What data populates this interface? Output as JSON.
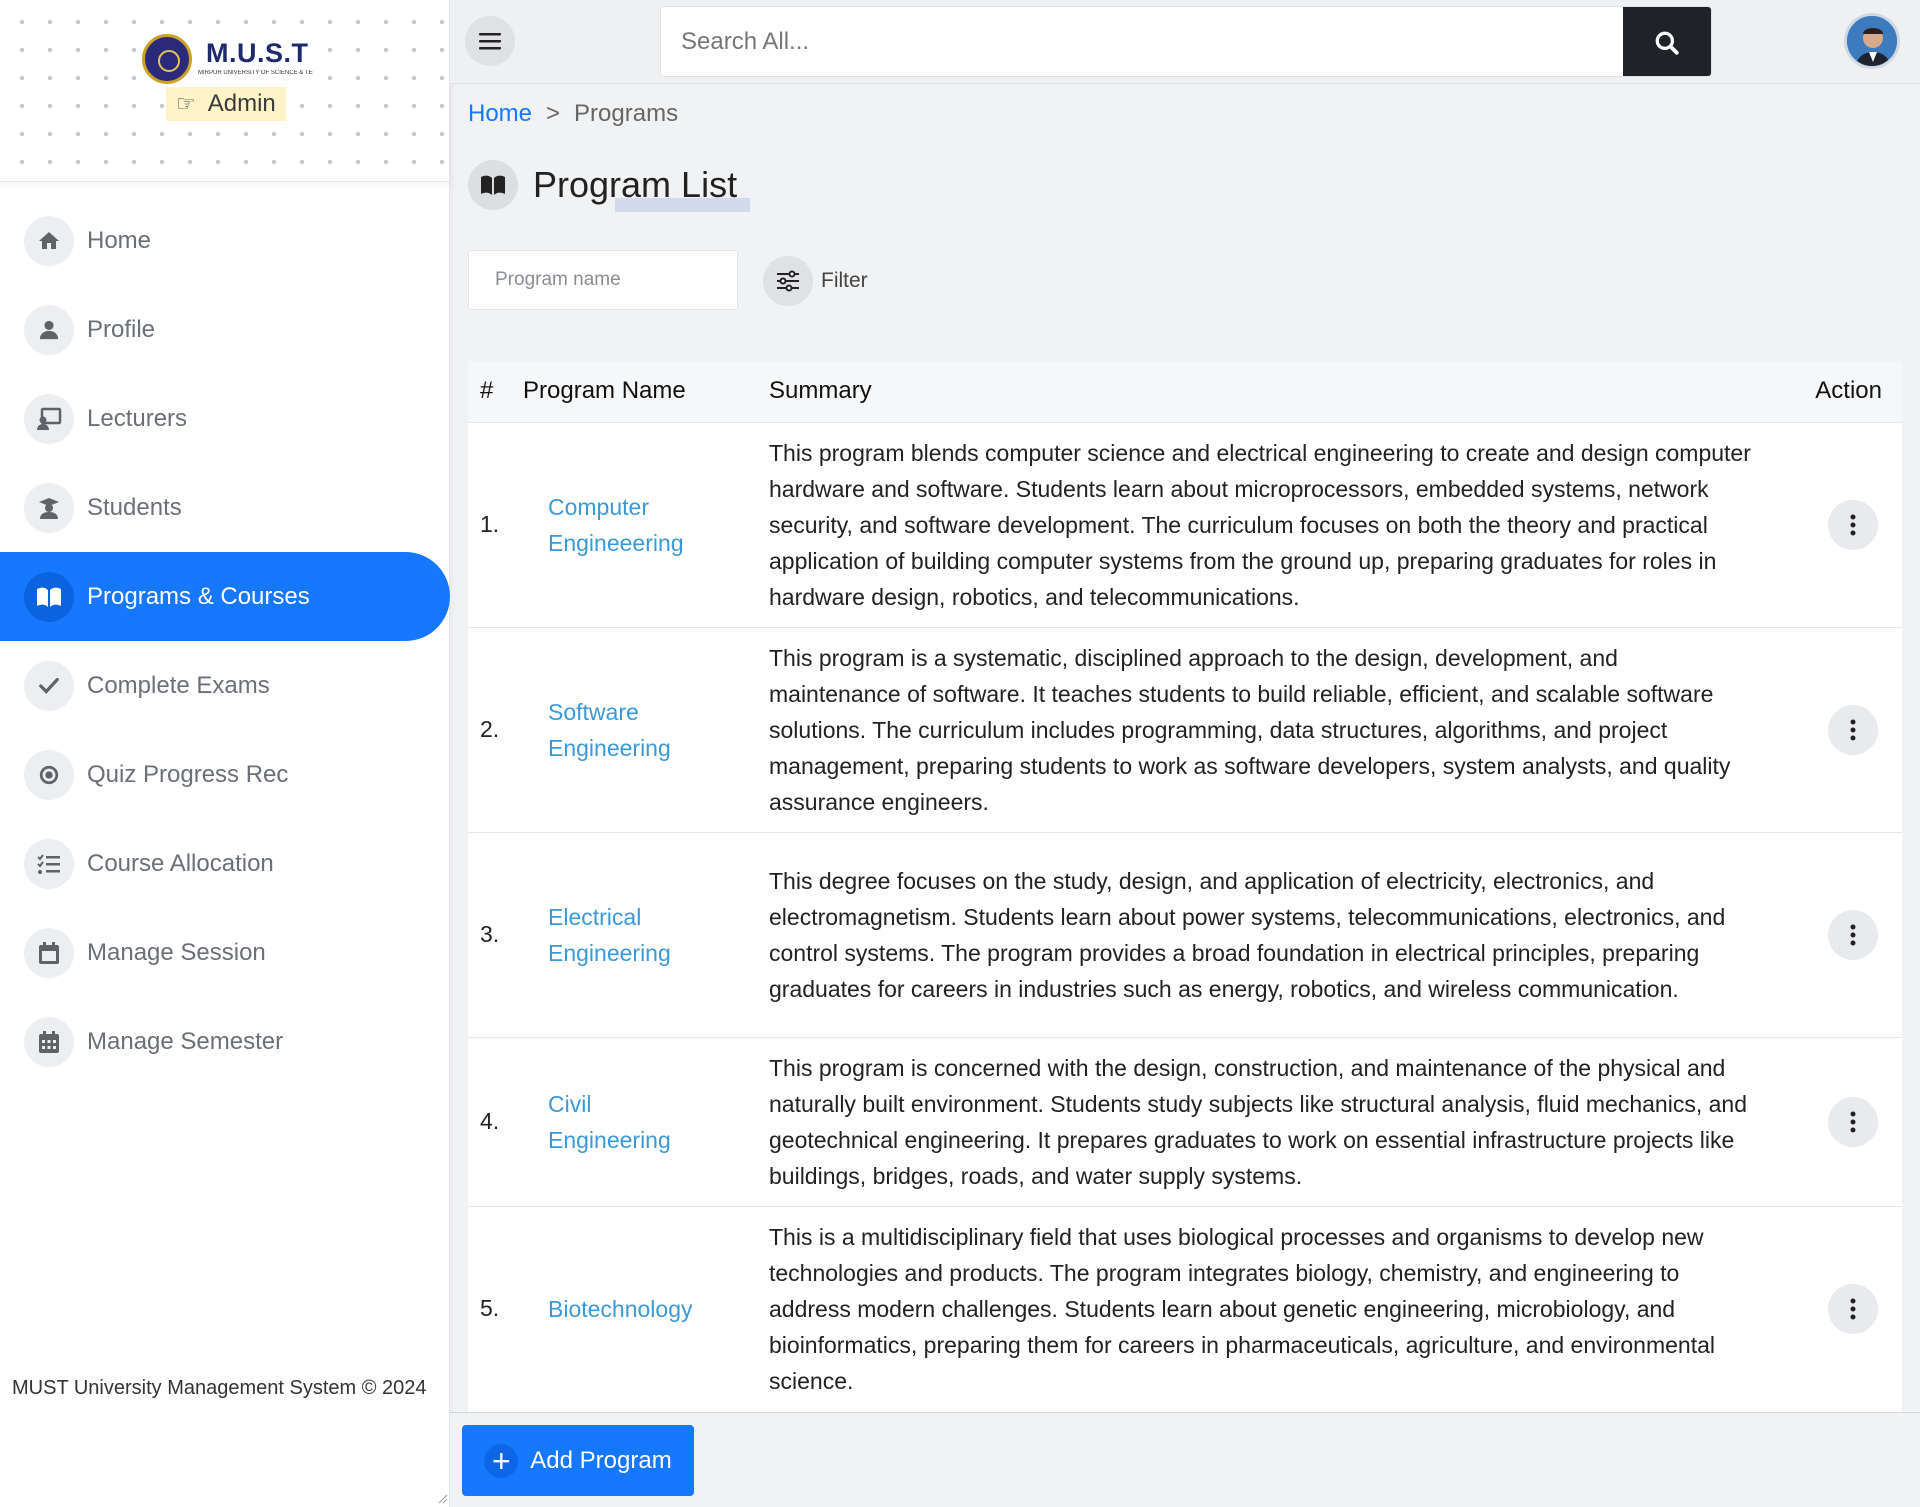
{
  "brand": {
    "name": "M.U.S.T",
    "subtitle": "MIRPUR UNIVERSITY OF SCIENCE & TECHNOLOGY",
    "role": "Admin"
  },
  "sidebar": {
    "items": [
      {
        "label": "Home",
        "icon": "home-icon"
      },
      {
        "label": "Profile",
        "icon": "user-icon"
      },
      {
        "label": "Lecturers",
        "icon": "chalkboard-teacher-icon"
      },
      {
        "label": "Students",
        "icon": "graduate-icon"
      },
      {
        "label": "Programs & Courses",
        "icon": "book-open-icon",
        "active": true
      },
      {
        "label": "Complete Exams",
        "icon": "check-icon"
      },
      {
        "label": "Quiz Progress Rec",
        "icon": "record-icon"
      },
      {
        "label": "Course Allocation",
        "icon": "list-check-icon"
      },
      {
        "label": "Manage Session",
        "icon": "calendar-icon"
      },
      {
        "label": "Manage Semester",
        "icon": "calendar-grid-icon"
      }
    ],
    "footer": "MUST University Management System © 2024"
  },
  "topbar": {
    "search_placeholder": "Search All..."
  },
  "breadcrumb": {
    "home": "Home",
    "separator": ">",
    "current": "Programs"
  },
  "page": {
    "title": "Program List",
    "program_name_placeholder": "Program name",
    "filter_label": "Filter"
  },
  "table": {
    "headers": {
      "num": "#",
      "name": "Program Name",
      "summary": "Summary",
      "action": "Action"
    },
    "rows": [
      {
        "num": "1.",
        "name_line1": "Computer",
        "name_line2": "Engineeering",
        "summary": "This program blends computer science and electrical engineering to create and design computer hardware and software. Students learn about microprocessors, embedded systems, network security, and software development. The curriculum focuses on both the theory and practical application of building computer systems from the ground up, preparing graduates for roles in hardware design, robotics, and telecommunications."
      },
      {
        "num": "2.",
        "name_line1": "Software",
        "name_line2": "Engineering",
        "summary": "This program is a systematic, disciplined approach to the design, development, and maintenance of software. It teaches students to build reliable, efficient, and scalable software solutions. The curriculum includes programming, data structures, algorithms, and project management, preparing students to work as software developers, system analysts, and quality assurance engineers."
      },
      {
        "num": "3.",
        "name_line1": "Electrical",
        "name_line2": "Engineering",
        "summary": "This degree focuses on the study, design, and application of electricity, electronics, and electromagnetism. Students learn about power systems, telecommunications, electronics, and control systems. The program provides a broad foundation in electrical principles, preparing graduates for careers in industries such as energy, robotics, and wireless communication."
      },
      {
        "num": "4.",
        "name_line1": "Civil",
        "name_line2": "Engineering",
        "summary": "This program is concerned with the design, construction, and maintenance of the physical and naturally built environment. Students study subjects like structural analysis, fluid mechanics, and geotechnical engineering. It prepares graduates to work on essential infrastructure projects like buildings, bridges, roads, and water supply systems."
      },
      {
        "num": "5.",
        "name_line1": "Biotechnology",
        "name_line2": "",
        "summary": "This is a multidisciplinary field that uses biological processes and organisms to develop new technologies and products. The program integrates biology, chemistry, and engineering to address modern challenges. Students learn about genetic engineering, microbiology, and bioinformatics, preparing them for careers in pharmaceuticals, agriculture, and environmental science."
      }
    ]
  },
  "actions": {
    "add_program": "Add Program"
  },
  "colors": {
    "primary": "#1677ff",
    "link": "#3a9ad9",
    "dark_button": "#1f2226"
  }
}
